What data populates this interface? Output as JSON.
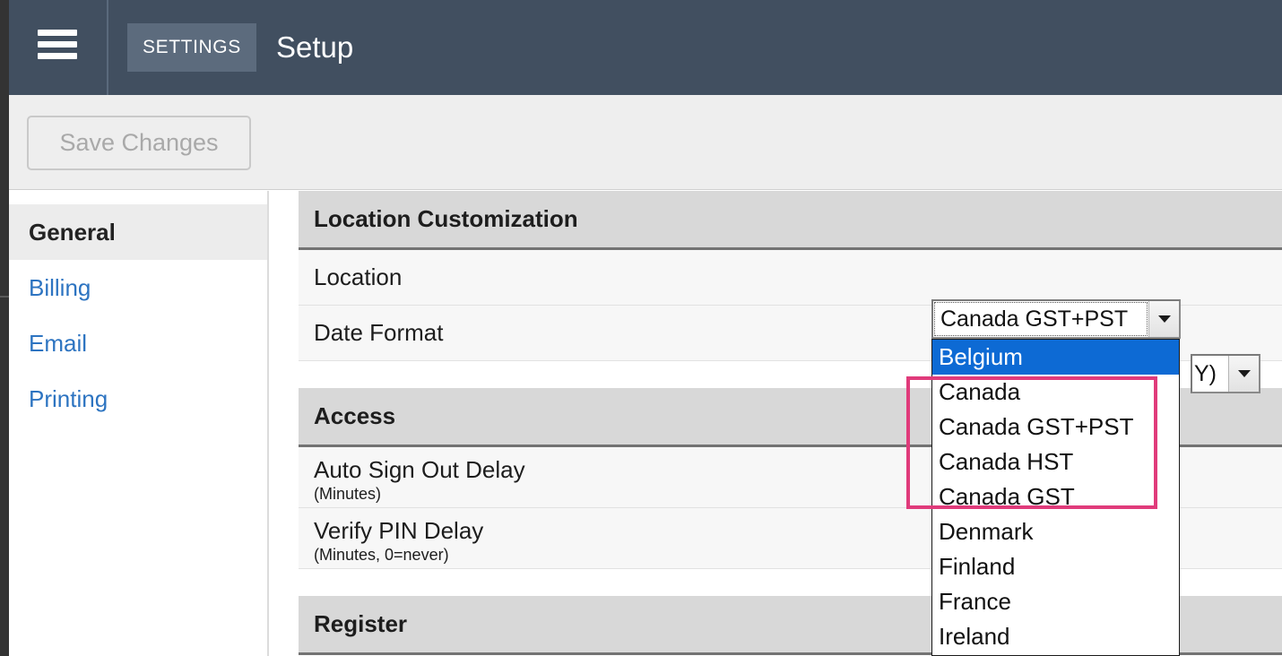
{
  "header": {
    "menu_icon": "hamburger-menu-icon",
    "badge_label": "SETTINGS",
    "title": "Setup",
    "bg_color": "#414f60",
    "badge_bg_color": "#5c6b7d"
  },
  "toolbar": {
    "save_label": "Save Changes",
    "save_disabled": true
  },
  "sidebar": {
    "items": [
      {
        "label": "General",
        "active": true
      },
      {
        "label": "Billing",
        "active": false
      },
      {
        "label": "Email",
        "active": false
      },
      {
        "label": "Printing",
        "active": false
      }
    ],
    "link_color": "#2d74c1",
    "active_bg_color": "#ececec"
  },
  "main": {
    "sections": [
      {
        "title": "Location Customization",
        "rows": [
          {
            "label": "Location",
            "sub": ""
          },
          {
            "label": "Date Format",
            "sub": ""
          }
        ]
      },
      {
        "title": "Access",
        "rows": [
          {
            "label": "Auto Sign Out Delay",
            "sub": "(Minutes)"
          },
          {
            "label": "Verify PIN Delay",
            "sub": "(Minutes, 0=never)"
          }
        ]
      },
      {
        "title": "Register",
        "rows": []
      }
    ]
  },
  "location_select": {
    "value": "Canada GST+PST",
    "arrow_icon": "chevron-down-icon",
    "open": true
  },
  "dateformat_select": {
    "value": "Y)",
    "arrow_icon": "chevron-down-icon",
    "open": false
  },
  "dropdown": {
    "highlighted": "Belgium",
    "highlight_color": "#0d6ad4",
    "options": [
      "Belgium",
      "Canada",
      "Canada GST+PST",
      "Canada HST",
      "Canada GST",
      "Denmark",
      "Finland",
      "France",
      "Ireland"
    ]
  },
  "annotation": {
    "type": "rectangle-highlight",
    "color": "#e03b7b",
    "covers": [
      "Canada",
      "Canada GST+PST",
      "Canada HST",
      "Canada GST"
    ]
  }
}
